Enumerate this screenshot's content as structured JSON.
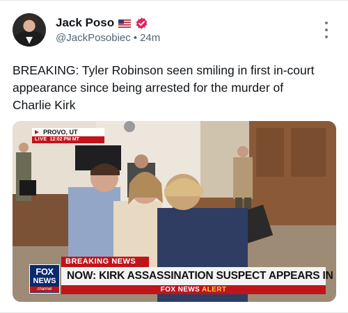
{
  "post": {
    "author": {
      "display_name": "Jack Poso",
      "handle": "@JackPosobiec",
      "flag_icon": "us-flag-icon",
      "verified_icon": "verified-badge-icon",
      "verified_color": "#e0245e"
    },
    "separator": "•",
    "timestamp": "24m",
    "more_icon": "more-vertical-icon",
    "text": "BREAKING: Tyler Robinson seen smiling in first in-court appearance since being arrested for the murder of Charlie Kirk",
    "media": {
      "location": "PROVO, UT",
      "live_label": "LIVE",
      "live_time": "12:02 PM MT",
      "breaking_label": "BREAKING NEWS",
      "headline": "NOW: KIRK ASSASSINATION SUSPECT APPEARS IN COURT",
      "alert_brand": "FOX NEWS",
      "alert_word": "ALERT",
      "logo_line1": "FOX",
      "logo_line2": "NEWS",
      "logo_line3": "channel",
      "accent_red": "#c0141b",
      "logo_blue": "#0a2a6e"
    }
  }
}
